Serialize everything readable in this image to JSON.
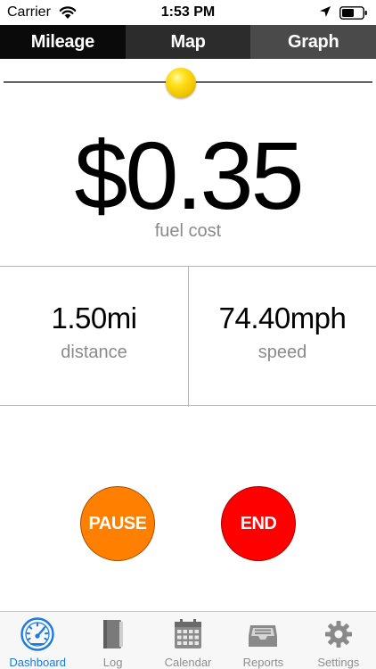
{
  "status_bar": {
    "carrier": "Carrier",
    "time": "1:53 PM"
  },
  "tabs": [
    {
      "label": "Mileage"
    },
    {
      "label": "Map"
    },
    {
      "label": "Graph"
    }
  ],
  "slider": {
    "value_fraction": 0.48
  },
  "fuel": {
    "value": "$0.35",
    "label": "fuel cost"
  },
  "distance": {
    "value": "1.50mi",
    "label": "distance"
  },
  "speed": {
    "value": "74.40mph",
    "label": "speed"
  },
  "buttons": {
    "pause": "PAUSE",
    "end": "END"
  },
  "tabbar": [
    {
      "label": "Dashboard",
      "icon": "dashboard-icon",
      "active": true
    },
    {
      "label": "Log",
      "icon": "book-icon",
      "active": false
    },
    {
      "label": "Calendar",
      "icon": "calendar-icon",
      "active": false
    },
    {
      "label": "Reports",
      "icon": "inbox-tray-icon",
      "active": false
    },
    {
      "label": "Settings",
      "icon": "gear-icon",
      "active": false
    }
  ],
  "colors": {
    "accent": "#1a7ae0",
    "pause": "#ff7f00",
    "end": "#ff0000",
    "thumb": "#ffe21a",
    "label_gray": "#8a8a8a"
  }
}
